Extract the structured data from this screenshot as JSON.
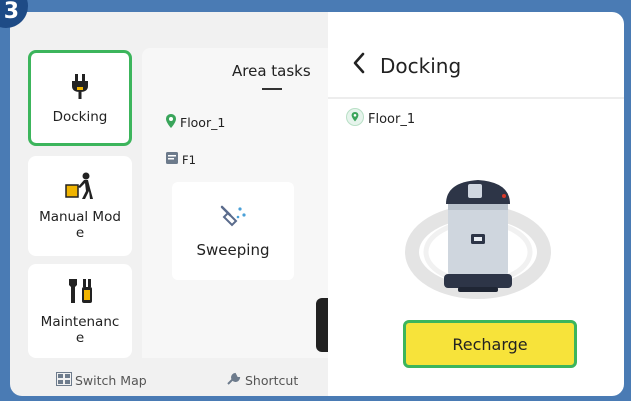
{
  "step_number": "3",
  "colors": {
    "accent_green": "#3cb55c",
    "recharge_yellow": "#f7e33a",
    "location_green": "#3aa55b",
    "frame_blue": "#4a7bb4"
  },
  "sidebar": {
    "items": [
      {
        "label": "Docking",
        "icon": "plug-icon",
        "active": true
      },
      {
        "label": "Manual Mod\ne",
        "icon": "pushing-cart-person-icon",
        "active": false
      },
      {
        "label": "Maintenanc\ne",
        "icon": "tools-icon",
        "active": false
      }
    ]
  },
  "main": {
    "title": "Area tasks",
    "location": "Floor_1",
    "map_label": "F1",
    "task": {
      "label": "Sweeping",
      "icon": "sweeping-icon"
    }
  },
  "bottom_bar": {
    "switch_map": "Switch Map",
    "shortcut": "Shortcut"
  },
  "docking_panel": {
    "title": "Docking",
    "location": "Floor_1",
    "robot_image": "robot-icon",
    "recharge_label": "Recharge"
  }
}
